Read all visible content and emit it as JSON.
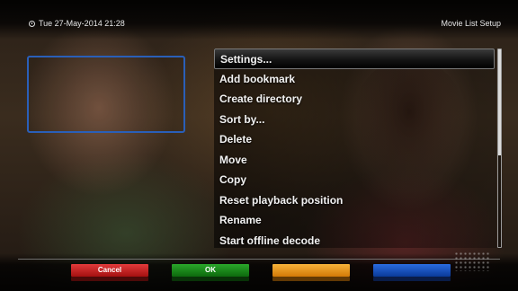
{
  "header": {
    "datetime": "Tue 27-May-2014 21:28",
    "screen_title": "Movie List Setup",
    "clock_icon": "clock-icon"
  },
  "menu": {
    "items": [
      {
        "label": "Settings..."
      },
      {
        "label": "Add bookmark"
      },
      {
        "label": "Create directory"
      },
      {
        "label": "Sort by..."
      },
      {
        "label": "Delete"
      },
      {
        "label": "Move"
      },
      {
        "label": "Copy"
      },
      {
        "label": "Reset playback position"
      },
      {
        "label": "Rename"
      },
      {
        "label": "Start offline decode"
      }
    ],
    "selected_index": 0
  },
  "buttons": {
    "red": {
      "label": "Cancel",
      "color": "#c42121"
    },
    "green": {
      "label": "OK",
      "color": "#1b8a1b"
    },
    "yellow": {
      "label": "",
      "color": "#f09a1a"
    },
    "blue": {
      "label": "",
      "color": "#1a53c4"
    }
  },
  "colors": {
    "preview_border": "#2a5fb8",
    "accent_selected": "#141414"
  }
}
